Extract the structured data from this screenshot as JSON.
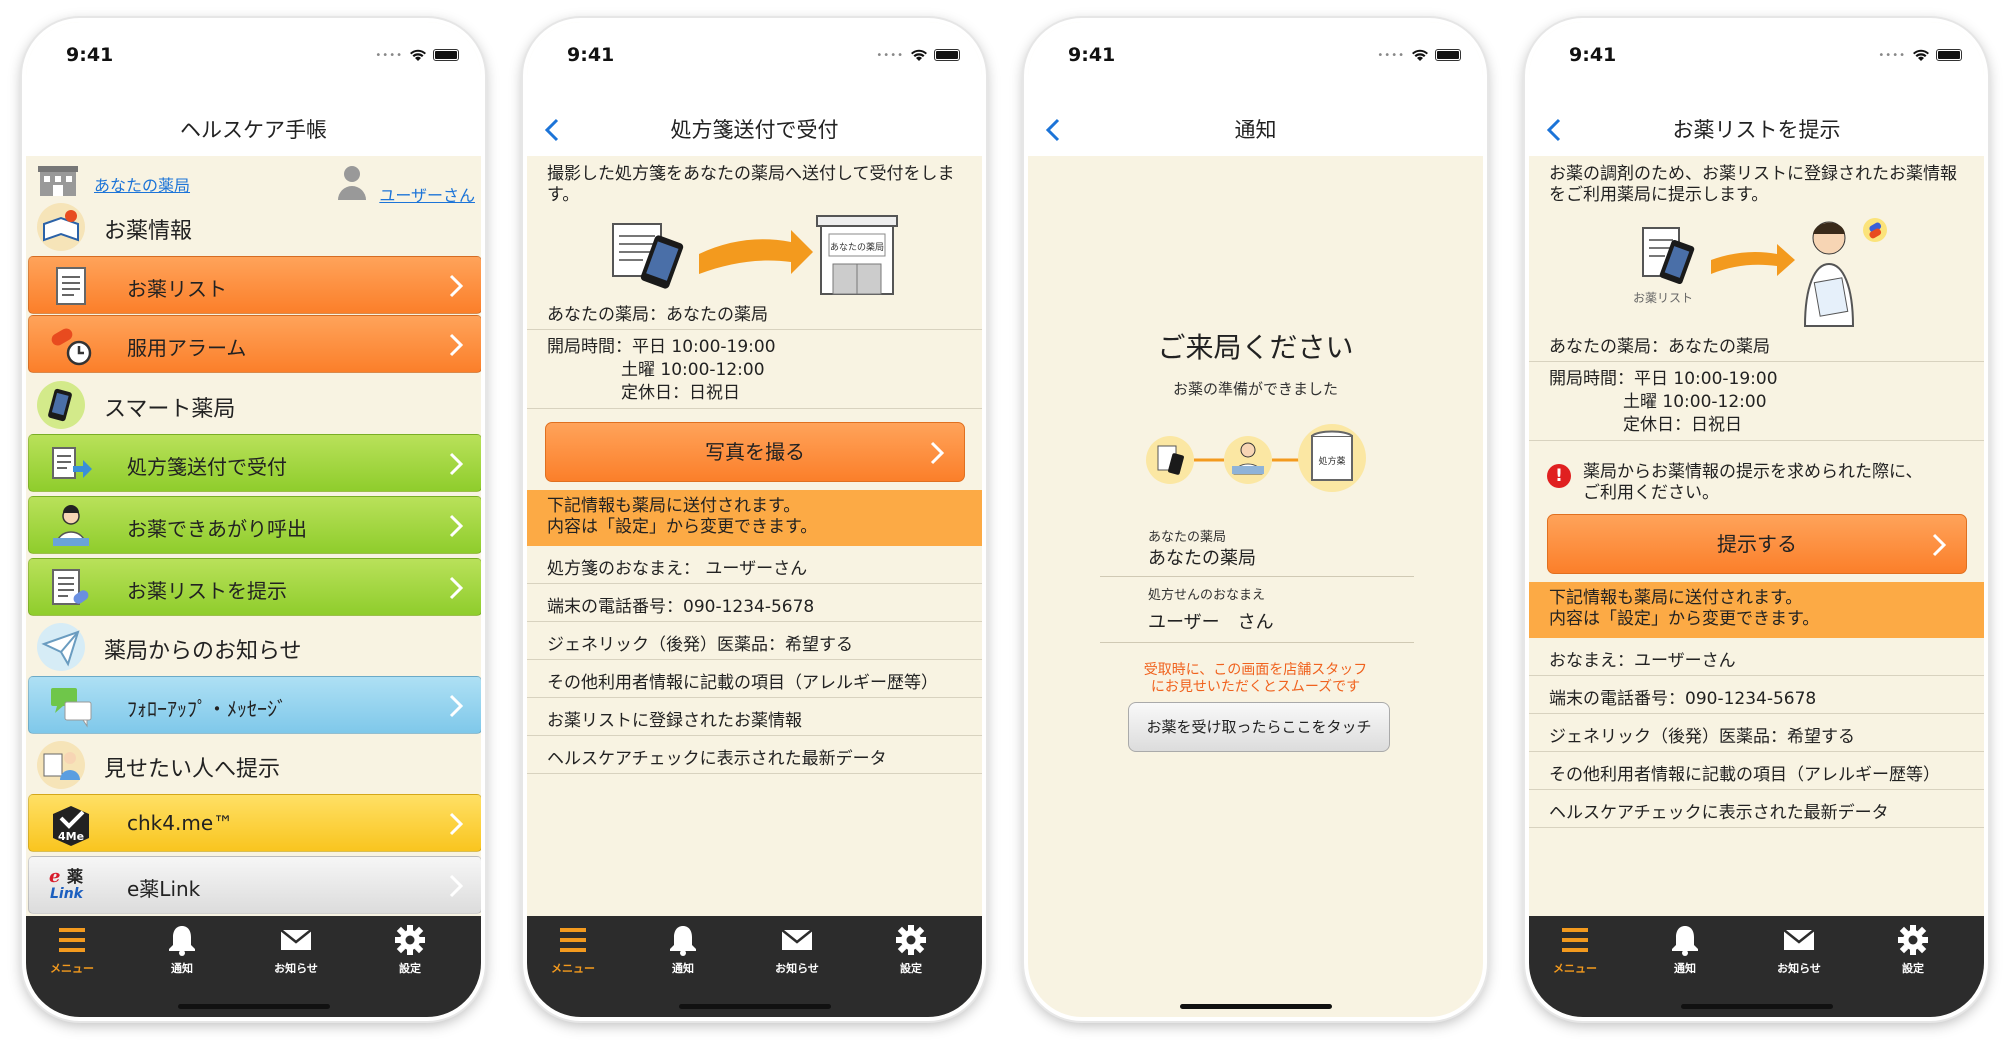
{
  "status": {
    "time": "9:41"
  },
  "tabs": [
    "メニュー",
    "通知",
    "お知らせ",
    "設定"
  ],
  "colors": {
    "accent_orange": "#fb7f2a",
    "accent_green": "#8fcd2c",
    "accent_blue": "#7fc8ea",
    "accent_yellow": "#f9c51f",
    "notice_banner": "#fcaa45",
    "link_blue": "#1c74d8",
    "background": "#f8f3e2",
    "tabbar": "#2c2c2c"
  },
  "phone1": {
    "title": "ヘルスケア手帳",
    "pharmacy_link": "あなたの薬局",
    "user_link": "ユーザーさん",
    "sections": [
      "お薬情報",
      "スマート薬局",
      "薬局からのお知らせ",
      "見せたい人へ提示"
    ],
    "menu": [
      "お薬リスト",
      "服用アラーム",
      "処方箋送付で受付",
      "お薬できあがり呼出",
      "お薬リストを提示",
      "ﾌｫﾛｰｱｯﾌﾟ・ﾒｯｾｰｼﾞ",
      "chk4.me™",
      "e薬Link"
    ]
  },
  "phone2": {
    "title": "処方箋送付で受付",
    "intro": "撮影した処方箋をあなたの薬局へ送付して受付をします。",
    "illustration_sign": "あなたの薬局",
    "pharmacy": "あなたの薬局：あなたの薬局",
    "hours": [
      "開局時間：平日 10:00-19:00",
      "土曜 10:00-12:00",
      "定休日：日祝日"
    ],
    "cta": "写真を撮る",
    "notice": [
      "下記情報も薬局に送付されます。",
      "内容は「設定」から変更できます。"
    ],
    "rows": [
      "処方箋のおなまえ： ユーザーさん",
      "端末の電話番号：090-1234-5678",
      "ジェネリック（後発）医薬品：希望する",
      "その他利用者情報に記載の項目（アレルギー歴等）",
      "お薬リストに登録されたお薬情報",
      "ヘルスケアチェックに表示された最新データ"
    ]
  },
  "phone3": {
    "title": "通知",
    "heading": "ご来局ください",
    "subheading": "お薬の準備ができました",
    "bag_label": "処方薬",
    "pharmacy_label": "あなたの薬局",
    "pharmacy_value": "あなたの薬局",
    "name_label": "処方せんのおなまえ",
    "name_value": "ユーザー　さん",
    "red_notice": [
      "受取時に、この画面を店舗スタッフ",
      "にお見せいただくとスムーズです"
    ],
    "button": "お薬を受け取ったらここをタッチ"
  },
  "phone4": {
    "title": "お薬リストを提示",
    "intro": "お薬の調剤のため、お薬リストに登録されたお薬情報をご利用薬局に提示します。",
    "illustration_caption": "お薬リスト",
    "pharmacy": "あなたの薬局：あなたの薬局",
    "hours": [
      "開局時間：平日 10:00-19:00",
      "土曜 10:00-12:00",
      "定休日：日祝日"
    ],
    "warning": [
      "薬局からお薬情報の提示を求められた際に、",
      "ご利用ください。"
    ],
    "cta": "提示する",
    "notice": [
      "下記情報も薬局に送付されます。",
      "内容は「設定」から変更できます。"
    ],
    "rows": [
      "おなまえ：ユーザーさん",
      "端末の電話番号：090-1234-5678",
      "ジェネリック（後発）医薬品：希望する",
      "その他利用者情報に記載の項目（アレルギー歴等）",
      "ヘルスケアチェックに表示された最新データ"
    ]
  }
}
